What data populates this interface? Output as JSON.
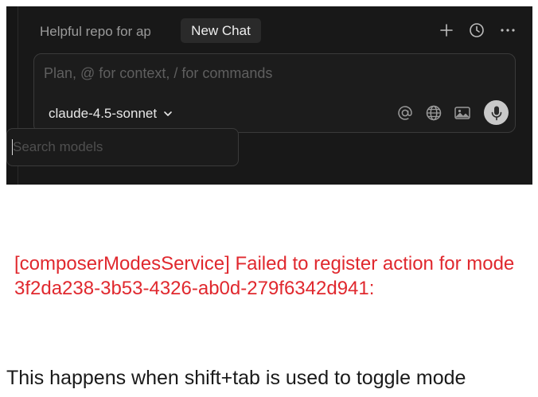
{
  "colors": {
    "panel_bg": "#181818",
    "active_tab_bg": "#2a2a2a",
    "error_text": "#e0282e",
    "body_text": "#1a1a1a",
    "mic_bg": "#c9c9c9"
  },
  "header": {
    "tab1_label": "Helpful repo for ap",
    "tab2_label": "New Chat",
    "icons": [
      "plus-icon",
      "history-clock-icon",
      "more-dots-icon"
    ]
  },
  "composer": {
    "placeholder": "Plan, @ for context, / for commands",
    "model_label": "claude-4.5-sonnet",
    "icons": [
      "at-mention-icon",
      "globe-icon",
      "image-icon",
      "microphone-icon"
    ]
  },
  "model_picker": {
    "search_placeholder": "Search models"
  },
  "post": {
    "error_message": "[composerModesService] Failed to register action for mode 3f2da238-3b53-4326-ab0d-279f6342d941:",
    "body_text": "This happens when shift+tab is used to toggle mode"
  }
}
